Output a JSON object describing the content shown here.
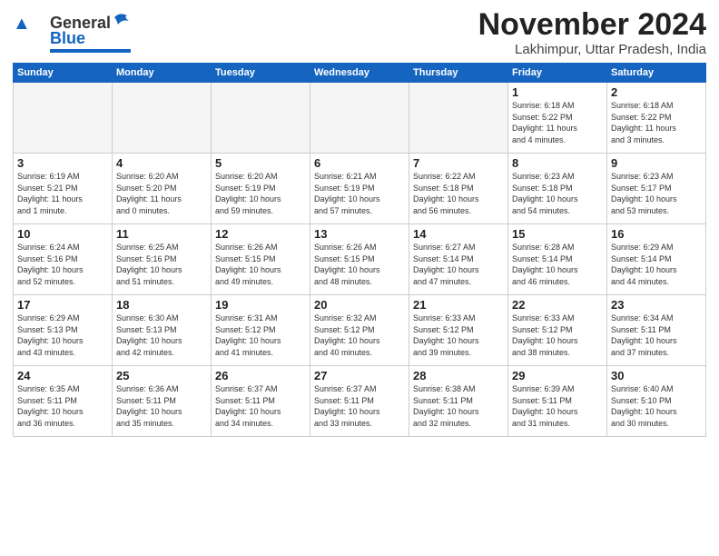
{
  "header": {
    "logo_line1": "General",
    "logo_line2": "Blue",
    "month": "November 2024",
    "location": "Lakhimpur, Uttar Pradesh, India"
  },
  "weekdays": [
    "Sunday",
    "Monday",
    "Tuesday",
    "Wednesday",
    "Thursday",
    "Friday",
    "Saturday"
  ],
  "weeks": [
    [
      {
        "day": "",
        "info": ""
      },
      {
        "day": "",
        "info": ""
      },
      {
        "day": "",
        "info": ""
      },
      {
        "day": "",
        "info": ""
      },
      {
        "day": "",
        "info": ""
      },
      {
        "day": "1",
        "info": "Sunrise: 6:18 AM\nSunset: 5:22 PM\nDaylight: 11 hours\nand 4 minutes."
      },
      {
        "day": "2",
        "info": "Sunrise: 6:18 AM\nSunset: 5:22 PM\nDaylight: 11 hours\nand 3 minutes."
      }
    ],
    [
      {
        "day": "3",
        "info": "Sunrise: 6:19 AM\nSunset: 5:21 PM\nDaylight: 11 hours\nand 1 minute."
      },
      {
        "day": "4",
        "info": "Sunrise: 6:20 AM\nSunset: 5:20 PM\nDaylight: 11 hours\nand 0 minutes."
      },
      {
        "day": "5",
        "info": "Sunrise: 6:20 AM\nSunset: 5:19 PM\nDaylight: 10 hours\nand 59 minutes."
      },
      {
        "day": "6",
        "info": "Sunrise: 6:21 AM\nSunset: 5:19 PM\nDaylight: 10 hours\nand 57 minutes."
      },
      {
        "day": "7",
        "info": "Sunrise: 6:22 AM\nSunset: 5:18 PM\nDaylight: 10 hours\nand 56 minutes."
      },
      {
        "day": "8",
        "info": "Sunrise: 6:23 AM\nSunset: 5:18 PM\nDaylight: 10 hours\nand 54 minutes."
      },
      {
        "day": "9",
        "info": "Sunrise: 6:23 AM\nSunset: 5:17 PM\nDaylight: 10 hours\nand 53 minutes."
      }
    ],
    [
      {
        "day": "10",
        "info": "Sunrise: 6:24 AM\nSunset: 5:16 PM\nDaylight: 10 hours\nand 52 minutes."
      },
      {
        "day": "11",
        "info": "Sunrise: 6:25 AM\nSunset: 5:16 PM\nDaylight: 10 hours\nand 51 minutes."
      },
      {
        "day": "12",
        "info": "Sunrise: 6:26 AM\nSunset: 5:15 PM\nDaylight: 10 hours\nand 49 minutes."
      },
      {
        "day": "13",
        "info": "Sunrise: 6:26 AM\nSunset: 5:15 PM\nDaylight: 10 hours\nand 48 minutes."
      },
      {
        "day": "14",
        "info": "Sunrise: 6:27 AM\nSunset: 5:14 PM\nDaylight: 10 hours\nand 47 minutes."
      },
      {
        "day": "15",
        "info": "Sunrise: 6:28 AM\nSunset: 5:14 PM\nDaylight: 10 hours\nand 46 minutes."
      },
      {
        "day": "16",
        "info": "Sunrise: 6:29 AM\nSunset: 5:14 PM\nDaylight: 10 hours\nand 44 minutes."
      }
    ],
    [
      {
        "day": "17",
        "info": "Sunrise: 6:29 AM\nSunset: 5:13 PM\nDaylight: 10 hours\nand 43 minutes."
      },
      {
        "day": "18",
        "info": "Sunrise: 6:30 AM\nSunset: 5:13 PM\nDaylight: 10 hours\nand 42 minutes."
      },
      {
        "day": "19",
        "info": "Sunrise: 6:31 AM\nSunset: 5:12 PM\nDaylight: 10 hours\nand 41 minutes."
      },
      {
        "day": "20",
        "info": "Sunrise: 6:32 AM\nSunset: 5:12 PM\nDaylight: 10 hours\nand 40 minutes."
      },
      {
        "day": "21",
        "info": "Sunrise: 6:33 AM\nSunset: 5:12 PM\nDaylight: 10 hours\nand 39 minutes."
      },
      {
        "day": "22",
        "info": "Sunrise: 6:33 AM\nSunset: 5:12 PM\nDaylight: 10 hours\nand 38 minutes."
      },
      {
        "day": "23",
        "info": "Sunrise: 6:34 AM\nSunset: 5:11 PM\nDaylight: 10 hours\nand 37 minutes."
      }
    ],
    [
      {
        "day": "24",
        "info": "Sunrise: 6:35 AM\nSunset: 5:11 PM\nDaylight: 10 hours\nand 36 minutes."
      },
      {
        "day": "25",
        "info": "Sunrise: 6:36 AM\nSunset: 5:11 PM\nDaylight: 10 hours\nand 35 minutes."
      },
      {
        "day": "26",
        "info": "Sunrise: 6:37 AM\nSunset: 5:11 PM\nDaylight: 10 hours\nand 34 minutes."
      },
      {
        "day": "27",
        "info": "Sunrise: 6:37 AM\nSunset: 5:11 PM\nDaylight: 10 hours\nand 33 minutes."
      },
      {
        "day": "28",
        "info": "Sunrise: 6:38 AM\nSunset: 5:11 PM\nDaylight: 10 hours\nand 32 minutes."
      },
      {
        "day": "29",
        "info": "Sunrise: 6:39 AM\nSunset: 5:11 PM\nDaylight: 10 hours\nand 31 minutes."
      },
      {
        "day": "30",
        "info": "Sunrise: 6:40 AM\nSunset: 5:10 PM\nDaylight: 10 hours\nand 30 minutes."
      }
    ]
  ]
}
